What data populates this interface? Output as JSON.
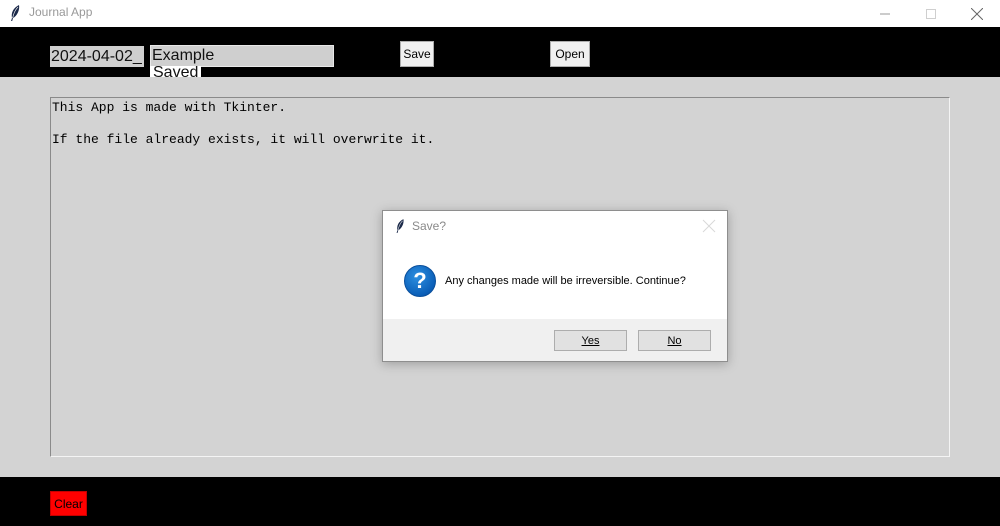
{
  "window": {
    "title": "Journal App",
    "icon": "feather-icon"
  },
  "toolbar": {
    "date_value": "2024-04-02_",
    "name_value": "Example",
    "saved_label": "Saved",
    "save_label": "Save",
    "open_label": "Open"
  },
  "editor": {
    "lines": [
      "This App is made with Tkinter.",
      "If the file already exists, it will overwrite it."
    ]
  },
  "bottom": {
    "clear_label": "Clear",
    "clear_color": "#ff0000"
  },
  "dialog": {
    "title": "Save?",
    "icon": "question-icon",
    "icon_glyph": "?",
    "message": "Any changes made will be irreversible. Continue?",
    "yes_label": "Yes",
    "no_label": "No"
  }
}
